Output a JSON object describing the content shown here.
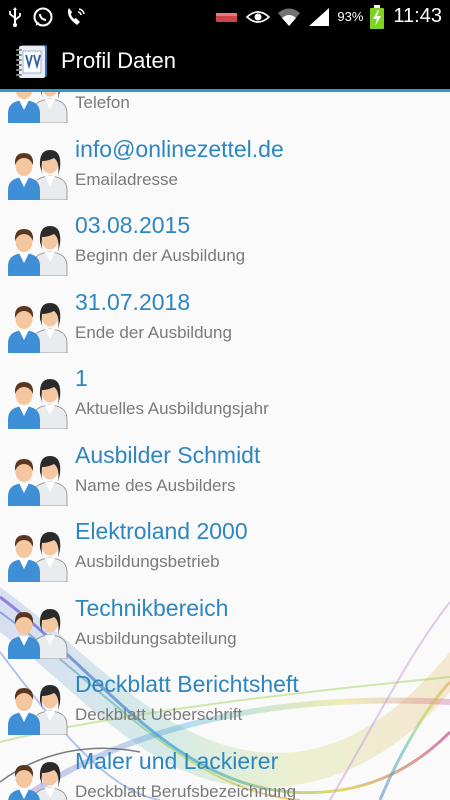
{
  "status_bar": {
    "battery_percent": "93%",
    "time": "11:43"
  },
  "action_bar": {
    "title": "Profil Daten"
  },
  "list": {
    "items": [
      {
        "value": "",
        "label": "Telefon"
      },
      {
        "value": "info@onlinezettel.de",
        "label": "Emailadresse"
      },
      {
        "value": "03.08.2015",
        "label": "Beginn der Ausbildung"
      },
      {
        "value": "31.07.2018",
        "label": "Ende der Ausbildung"
      },
      {
        "value": "1",
        "label": "Aktuelles Ausbildungsjahr"
      },
      {
        "value": "Ausbilder Schmidt",
        "label": "Name des Ausbilders"
      },
      {
        "value": "Elektroland 2000",
        "label": "Ausbildungsbetrieb"
      },
      {
        "value": "Technikbereich",
        "label": "Ausbildungsabteilung"
      },
      {
        "value": "Deckblatt Berichtsheft",
        "label": "Deckblatt Ueberschrift"
      },
      {
        "value": "Maler und Lackierer",
        "label": "Deckblatt Berufsbezeichnung"
      }
    ]
  },
  "colors": {
    "accent": "#2f97d0",
    "value_text": "#2e86c1",
    "label_text": "#7a7a7a",
    "background": "#fafafa"
  },
  "icons": [
    "usb-icon",
    "whatsapp-icon",
    "phone-icon",
    "battery-low-icon",
    "eye-icon",
    "wifi-icon",
    "signal-icon",
    "battery-charging-icon",
    "app-logo-icon",
    "user-pair-avatar-icon"
  ]
}
